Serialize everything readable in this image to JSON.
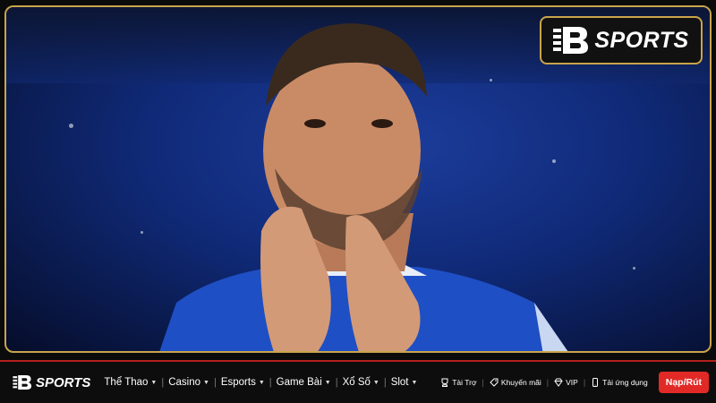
{
  "hero": {
    "image": "football player in blue jersey applauding"
  },
  "badge": {
    "brand": "SPORTS",
    "icon": "b-logo-icon"
  },
  "nav": {
    "brand": "SPORTS",
    "items": [
      {
        "label": "Thể Thao"
      },
      {
        "label": "Casino"
      },
      {
        "label": "Esports"
      },
      {
        "label": "Game Bài"
      },
      {
        "label": "Xổ Số"
      },
      {
        "label": "Slot"
      }
    ],
    "utilities": [
      {
        "label": "Tài Trợ",
        "icon": "trophy-icon"
      },
      {
        "label": "Khuyến mãi",
        "icon": "tag-icon"
      },
      {
        "label": "VIP",
        "icon": "diamond-icon"
      },
      {
        "label": "Tải ứng dụng",
        "icon": "phone-icon"
      }
    ],
    "cta": "Nạp/Rút"
  },
  "colors": {
    "accent_gold": "#c9a44a",
    "accent_red": "#e12a26"
  }
}
